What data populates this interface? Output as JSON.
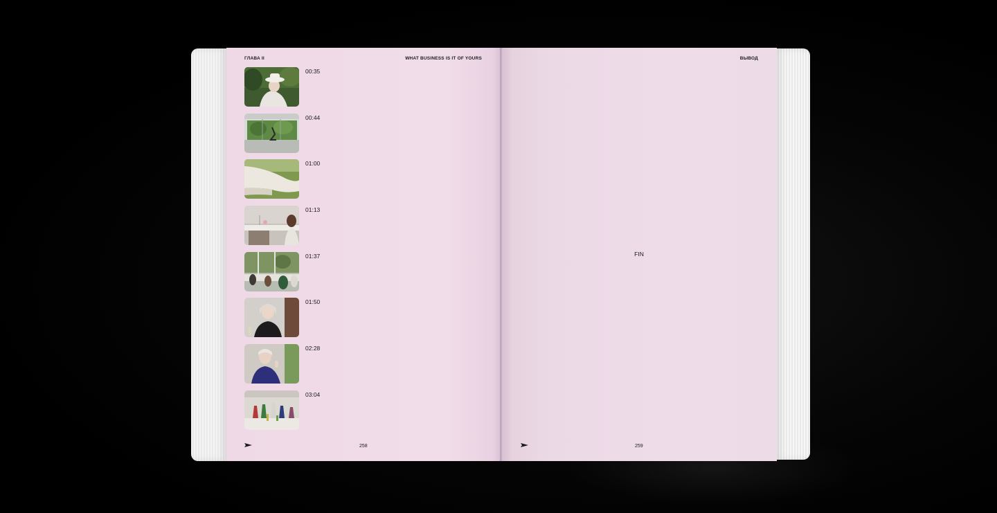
{
  "left_page": {
    "chapter_label": "ГЛАВА II",
    "title": "WHAT BUSINESS IS IT OF YOURS",
    "page_number": "258",
    "entries": [
      {
        "timecode": "00:35",
        "icon": "thumb-woman-white-hat-icon"
      },
      {
        "timecode": "00:44",
        "icon": "thumb-glass-room-icon"
      },
      {
        "timecode": "01:00",
        "icon": "thumb-white-sleeve-icon"
      },
      {
        "timecode": "01:13",
        "icon": "thumb-dining-table-icon"
      },
      {
        "timecode": "01:37",
        "icon": "thumb-terrace-lunch-icon"
      },
      {
        "timecode": "01:50",
        "icon": "thumb-woman-black-dress-icon"
      },
      {
        "timecode": "02:28",
        "icon": "thumb-woman-blue-top-icon"
      },
      {
        "timecode": "03:04",
        "icon": "thumb-dancing-group-icon"
      }
    ]
  },
  "right_page": {
    "section_label": "ВЫВОД",
    "center_text": "FIN",
    "page_number": "259"
  },
  "colors": {
    "page_pink": "#efdae8",
    "text": "#1a1a1a",
    "background": "#000000"
  }
}
